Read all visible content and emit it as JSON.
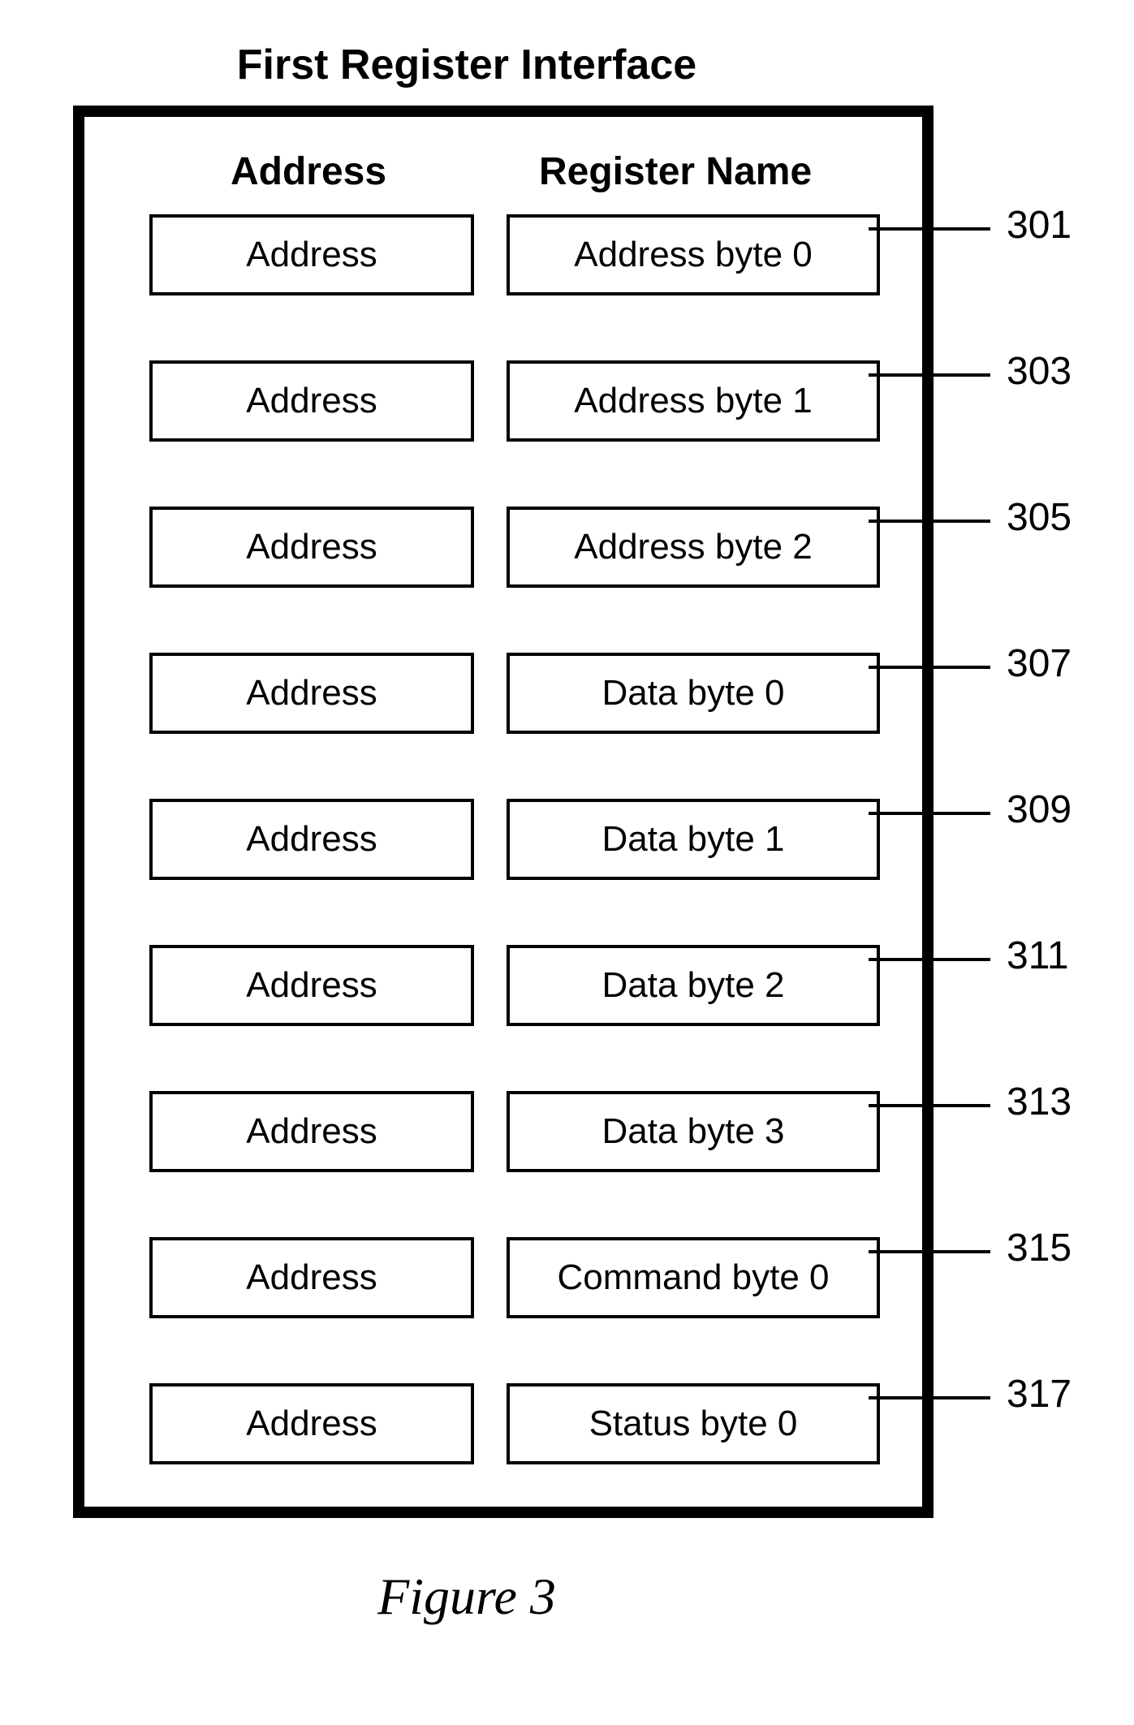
{
  "title": "First Register Interface",
  "headers": {
    "address": "Address",
    "register": "Register Name"
  },
  "rows": [
    {
      "address": "Address",
      "register": "Address byte 0",
      "ref": "301"
    },
    {
      "address": "Address",
      "register": "Address byte 1",
      "ref": "303"
    },
    {
      "address": "Address",
      "register": "Address byte 2",
      "ref": "305"
    },
    {
      "address": "Address",
      "register": "Data byte 0",
      "ref": "307"
    },
    {
      "address": "Address",
      "register": "Data byte 1",
      "ref": "309"
    },
    {
      "address": "Address",
      "register": "Data byte 2",
      "ref": "311"
    },
    {
      "address": "Address",
      "register": "Data byte 3",
      "ref": "313"
    },
    {
      "address": "Address",
      "register": "Command byte 0",
      "ref": "315"
    },
    {
      "address": "Address",
      "register": "Status byte 0",
      "ref": "317"
    }
  ],
  "caption": "Figure 3"
}
